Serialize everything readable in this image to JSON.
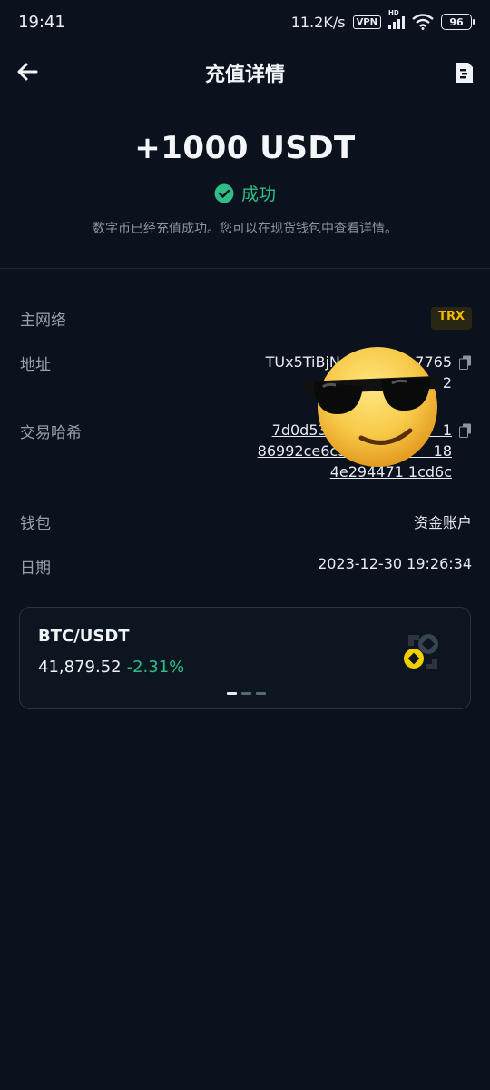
{
  "status_bar": {
    "time": "19:41",
    "speed": "11.2K/s",
    "vpn": "VPN",
    "hd": "HD",
    "battery": "96"
  },
  "header": {
    "title": "充值详情",
    "back_icon": "arrow-left-icon",
    "doc_icon": "document-icon"
  },
  "summary": {
    "amount": "+1000 USDT",
    "status": "成功",
    "description": "数字币已经充值成功。您可以在现货钱包中查看详情。"
  },
  "details": {
    "network": {
      "label": "主网络",
      "value": "TRX"
    },
    "address": {
      "label": "地址",
      "lines": [
        "TUx5TiBjNoEurn/      7765",
        "                          2"
      ]
    },
    "tx_hash": {
      "label": "交易哈希",
      "lines": [
        "7d0d5331bd3               1",
        "86992ce6c3c0               18",
        "4e294471 1cd6c"
      ]
    },
    "wallet": {
      "label": "钱包",
      "value": "资金账户"
    },
    "date": {
      "label": "日期",
      "value": "2023-12-30 19:26:34"
    }
  },
  "ticker": {
    "pair": "BTC/USDT",
    "price": "41,879.52",
    "change": "-2.31%",
    "page_count": 3,
    "active_page": 1
  },
  "colors": {
    "background": "#0b121d",
    "success": "#2ebd85",
    "accent": "#f0b90b"
  }
}
